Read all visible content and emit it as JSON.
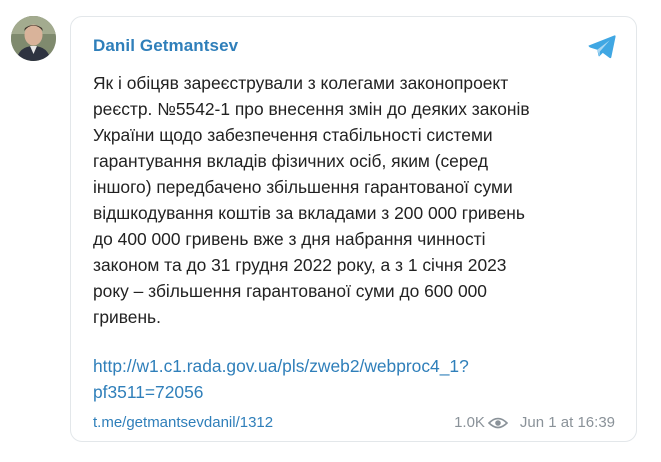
{
  "post": {
    "author": "Danil Getmantsev",
    "text": "Як і обіцяв зареєстрували з колегами законопроект\nреєстр. №5542-1 про внесення змін до деяких законів\nУкраїни щодо забезпечення стабільності системи\nгарантування вкладів фізичних осіб, яким (серед\nіншого) передбачено збільшення гарантованої суми\nвідшкодування коштів за вкладами з 200 000 гривень\nдо 400 000 гривень вже з дня набрання чинності\nзаконом та до 31 грудня 2022 року, а з 1 січня 2023\nроку – збільшення гарантованої суми до 600 000\nгривень.",
    "link": "http://w1.c1.rada.gov.ua/pls/zweb2/webproc4_1?\npf3511=72056",
    "post_link": "t.me/getmantsevdanil/1312",
    "views": "1.0K",
    "date": "Jun 1 at 16:39"
  },
  "icons": {
    "telegram": "telegram-icon",
    "views": "eye-icon",
    "avatar": "avatar"
  },
  "colors": {
    "link": "#2f7fba",
    "telegram": "#40a7e3",
    "muted": "#8a9299",
    "text": "#222222",
    "border": "#e3e7ea"
  }
}
